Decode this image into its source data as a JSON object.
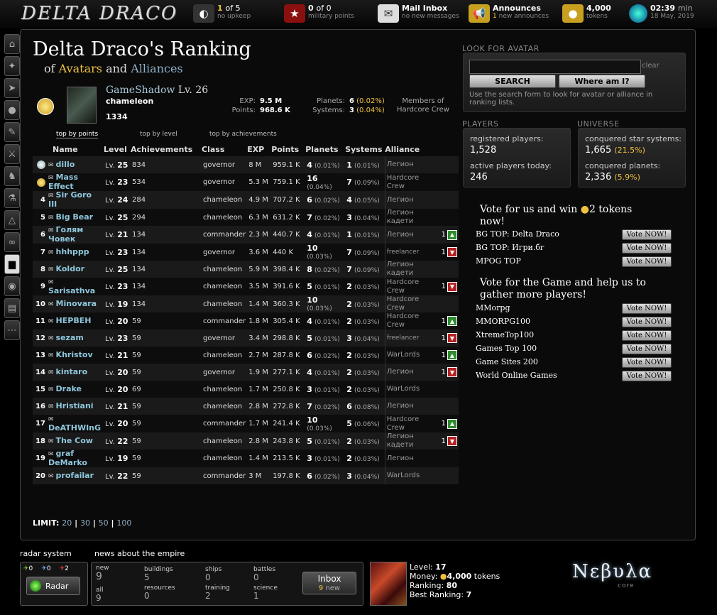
{
  "topbar": {
    "logo": "DELTA DRACO",
    "planets": {
      "count": "1",
      "of": "of 5",
      "sub": "no upkeep"
    },
    "military": {
      "count": "0",
      "of": "of 0",
      "sub": "military points"
    },
    "mail": {
      "title": "Mail Inbox",
      "sub": "no new messages"
    },
    "announces": {
      "title": "Announces",
      "count": "1",
      "sub": "new announces"
    },
    "tokens": {
      "count": "4,000",
      "sub": "tokens"
    },
    "time": {
      "value": "02:39",
      "unit": "min",
      "date": "18 May, 2019"
    }
  },
  "side_icons": [
    "home-icon",
    "map-icon",
    "fleet-icon",
    "planet-icon",
    "research-icon",
    "military-icon",
    "training-icon",
    "lab-icon",
    "alliance-icon",
    "diplomacy-icon",
    "ranking-icon",
    "eye-icon",
    "cards-icon",
    "more-icon"
  ],
  "header": {
    "title": "Delta Draco's Ranking",
    "sub_of": "of",
    "sub_avatars": "Avatars",
    "sub_and": "and",
    "sub_alliances": "Alliances"
  },
  "profile": {
    "name": "GameShadow",
    "level": "Lv. 26",
    "class": "chameleon",
    "rank": "1334",
    "exp_label": "EXP:",
    "exp": "9.5 M",
    "points_label": "Points:",
    "points": "968.6 K",
    "planets_label": "Planets:",
    "planets": "6",
    "planets_pct": "(0.02%)",
    "systems_label": "Systems:",
    "systems": "3",
    "systems_pct": "(0.04%)",
    "members_line1": "Members of",
    "members_line2": "Hardcore Crew"
  },
  "sort_links": [
    "top by points",
    "top by level",
    "top by achievements"
  ],
  "table": {
    "headers": [
      "Name",
      "Level",
      "Achievements",
      "Class",
      "EXP",
      "Points",
      "Planets",
      "Systems",
      "Alliance"
    ],
    "rows": [
      {
        "rank": "",
        "name": "dillo",
        "lv": "25",
        "ach": "834",
        "cls": "governor",
        "exp": "8 M",
        "pts": "959.1 K",
        "pl": "4",
        "plp": "(0.01%)",
        "sy": "1",
        "syp": "(0.01%)",
        "al": "Легион",
        "medal": "silver"
      },
      {
        "rank": "",
        "name": "Mass Effect",
        "lv": "23",
        "ach": "534",
        "cls": "governor",
        "exp": "5.3 M",
        "pts": "759.1 K",
        "pl": "16",
        "plp": "(0.04%)",
        "sy": "7",
        "syp": "(0.09%)",
        "al": "Hardcore Crew",
        "medal": "gold"
      },
      {
        "rank": "4",
        "name": "Sir Goro III",
        "lv": "24",
        "ach": "284",
        "cls": "chameleon",
        "exp": "4.9 M",
        "pts": "707.2 K",
        "pl": "6",
        "plp": "(0.02%)",
        "sy": "4",
        "syp": "(0.05%)",
        "al": "Легион"
      },
      {
        "rank": "5",
        "name": "Big Bear",
        "lv": "25",
        "ach": "294",
        "cls": "chameleon",
        "exp": "6.3 M",
        "pts": "631.2 K",
        "pl": "7",
        "plp": "(0.02%)",
        "sy": "3",
        "syp": "(0.04%)",
        "al": "Легион кадети"
      },
      {
        "rank": "6",
        "name": "Голям Човек",
        "lv": "21",
        "ach": "134",
        "cls": "commander",
        "exp": "2.3 M",
        "pts": "440.7 K",
        "pl": "4",
        "plp": "(0.01%)",
        "sy": "1",
        "syp": "(0.01%)",
        "al": "Легион",
        "vote": "1",
        "vdir": "up"
      },
      {
        "rank": "7",
        "name": "hhhppp",
        "lv": "23",
        "ach": "134",
        "cls": "governor",
        "exp": "3.6 M",
        "pts": "440 K",
        "pl": "10",
        "plp": "(0.03%)",
        "sy": "7",
        "syp": "(0.09%)",
        "al": "freelancer",
        "vote": "1",
        "vdir": "dn"
      },
      {
        "rank": "8",
        "name": "Koldor",
        "lv": "25",
        "ach": "134",
        "cls": "chameleon",
        "exp": "5.9 M",
        "pts": "398.4 K",
        "pl": "8",
        "plp": "(0.02%)",
        "sy": "7",
        "syp": "(0.09%)",
        "al": "Легион кадети"
      },
      {
        "rank": "9",
        "name": "Sarisathva",
        "lv": "23",
        "ach": "134",
        "cls": "chameleon",
        "exp": "3.5 M",
        "pts": "391.6 K",
        "pl": "5",
        "plp": "(0.01%)",
        "sy": "2",
        "syp": "(0.03%)",
        "al": "Hardcore Crew",
        "vote": "1",
        "vdir": "dn"
      },
      {
        "rank": "10",
        "name": "Minovara",
        "lv": "19",
        "ach": "134",
        "cls": "chameleon",
        "exp": "1.4 M",
        "pts": "360.3 K",
        "pl": "10",
        "plp": "(0.03%)",
        "sy": "2",
        "syp": "(0.03%)",
        "al": "Hardcore Crew"
      },
      {
        "rank": "11",
        "name": "HEPBEH",
        "lv": "20",
        "ach": "59",
        "cls": "commander",
        "exp": "1.8 M",
        "pts": "305.4 K",
        "pl": "4",
        "plp": "(0.01%)",
        "sy": "2",
        "syp": "(0.03%)",
        "al": "Hardcore Crew",
        "vote": "1",
        "vdir": "up"
      },
      {
        "rank": "12",
        "name": "sezam",
        "lv": "23",
        "ach": "59",
        "cls": "governor",
        "exp": "3.4 M",
        "pts": "298.8 K",
        "pl": "5",
        "plp": "(0.01%)",
        "sy": "3",
        "syp": "(0.04%)",
        "al": "freelancer",
        "vote": "1",
        "vdir": "dn"
      },
      {
        "rank": "13",
        "name": "Khristov",
        "lv": "21",
        "ach": "59",
        "cls": "chameleon",
        "exp": "2.7 M",
        "pts": "287.8 K",
        "pl": "6",
        "plp": "(0.02%)",
        "sy": "2",
        "syp": "(0.03%)",
        "al": "WarLords",
        "vote": "1",
        "vdir": "up"
      },
      {
        "rank": "14",
        "name": "kintaro",
        "lv": "20",
        "ach": "59",
        "cls": "governor",
        "exp": "1.9 M",
        "pts": "277.1 K",
        "pl": "4",
        "plp": "(0.01%)",
        "sy": "2",
        "syp": "(0.03%)",
        "al": "Легион",
        "vote": "1",
        "vdir": "dn"
      },
      {
        "rank": "15",
        "name": "Drake",
        "lv": "20",
        "ach": "69",
        "cls": "chameleon",
        "exp": "1.7 M",
        "pts": "250.8 K",
        "pl": "3",
        "plp": "(0.01%)",
        "sy": "2",
        "syp": "(0.03%)",
        "al": "WarLords"
      },
      {
        "rank": "16",
        "name": "Hristiani",
        "lv": "21",
        "ach": "59",
        "cls": "chameleon",
        "exp": "2.8 M",
        "pts": "272.8 K",
        "pl": "7",
        "plp": "(0.02%)",
        "sy": "6",
        "syp": "(0.08%)",
        "al": "Легион"
      },
      {
        "rank": "17",
        "name": "DeATHWInG",
        "lv": "20",
        "ach": "59",
        "cls": "commander",
        "exp": "1.7 M",
        "pts": "241.4 K",
        "pl": "10",
        "plp": "(0.03%)",
        "sy": "5",
        "syp": "(0.06%)",
        "al": "Hardcore Crew",
        "vote": "1",
        "vdir": "up"
      },
      {
        "rank": "18",
        "name": "The Cow",
        "lv": "22",
        "ach": "59",
        "cls": "chameleon",
        "exp": "2.8 M",
        "pts": "243.8 K",
        "pl": "5",
        "plp": "(0.01%)",
        "sy": "2",
        "syp": "(0.03%)",
        "al": "Легион кадети",
        "vote": "1",
        "vdir": "dn"
      },
      {
        "rank": "19",
        "name": "graf DeMarko",
        "lv": "19",
        "ach": "59",
        "cls": "chameleon",
        "exp": "1.4 M",
        "pts": "213.5 K",
        "pl": "3",
        "plp": "(0.01%)",
        "sy": "2",
        "syp": "(0.03%)",
        "al": "Легион"
      },
      {
        "rank": "20",
        "name": "profailar",
        "lv": "22",
        "ach": "59",
        "cls": "commander",
        "exp": "3 M",
        "pts": "197.8 K",
        "pl": "6",
        "plp": "(0.02%)",
        "sy": "3",
        "syp": "(0.04%)",
        "al": "WarLords"
      }
    ]
  },
  "limit": {
    "label": "LIMIT:",
    "options": [
      "20",
      "30",
      "50",
      "100"
    ]
  },
  "look": {
    "heading": "LOOK FOR AVATAR",
    "input_value": "",
    "clear": "clear",
    "search_btn": "SEARCH",
    "where_btn": "Where am I?",
    "hint": "Use the search form to look for avatar or alliance in ranking lists."
  },
  "players": {
    "heading": "PLAYERS",
    "reg_label": "registered players:",
    "reg_value": "1,528",
    "active_label": "active players today:",
    "active_value": "246"
  },
  "universe": {
    "heading": "UNIVERSE",
    "sys_label": "conquered star systems:",
    "sys_value": "1,665",
    "sys_pct": "(21.5%)",
    "pl_label": "conquered planets:",
    "pl_value": "2,336",
    "pl_pct": "(5.9%)"
  },
  "vote1": {
    "heading_a": "Vote for us and win",
    "heading_b": "2 tokens",
    "heading_c": "now!",
    "sites": [
      "BG TOP: Delta Draco",
      "BG TOP: Игри.бг",
      "MPOG TOP"
    ]
  },
  "vote2": {
    "heading": "Vote for the Game and help us to gather more players!",
    "sites": [
      "MMorpg",
      "MMORPG100",
      "XtremeTop100",
      "Games Top 100",
      "Game Sites 200",
      "World Online Games"
    ]
  },
  "vote_btn": "Vote NOW!",
  "radar": {
    "heading": "radar system",
    "c1": "0",
    "c2": "0",
    "c3": "2",
    "btn": "Radar"
  },
  "news": {
    "heading": "news about the empire",
    "new_label": "new",
    "new_value": "9",
    "all_label": "all",
    "all_value": "9",
    "buildings_label": "buildings",
    "buildings_value": "5",
    "resources_label": "resources",
    "resources_value": "0",
    "ships_label": "ships",
    "ships_value": "0",
    "training_label": "training",
    "training_value": "2",
    "battles_label": "battles",
    "battles_value": "0",
    "science_label": "science",
    "science_value": "1",
    "inbox_label": "Inbox",
    "inbox_new": "9",
    "inbox_new_label": "new"
  },
  "bottom_stats": {
    "level_label": "Level:",
    "level": "17",
    "money_label": "Money:",
    "money": "4,000",
    "money_unit": "tokens",
    "ranking_label": "Ranking:",
    "ranking": "80",
    "best_label": "Best Ranking:",
    "best": "7"
  },
  "brand": {
    "name": "Nεβυλα",
    "sub": "core"
  }
}
